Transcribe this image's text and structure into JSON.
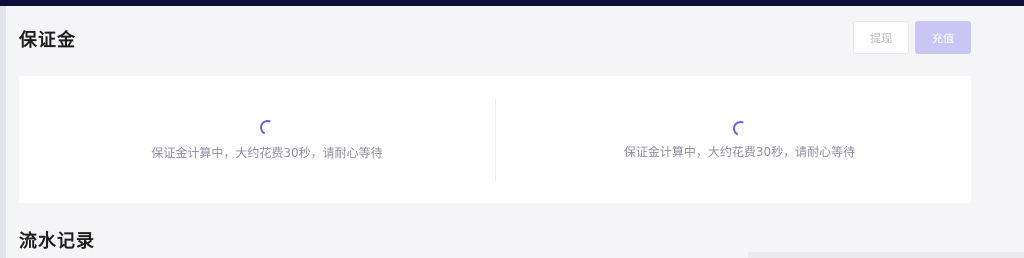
{
  "deposit": {
    "title": "保证金",
    "withdraw_label": "提现",
    "recharge_label": "充值",
    "panels": [
      {
        "loading_text": "保证金计算中，大约花费30秒，请耐心等待"
      },
      {
        "loading_text": "保证金计算中，大约花费30秒，请耐心等待"
      }
    ]
  },
  "flow": {
    "title": "流水记录"
  },
  "colors": {
    "topbar": "#0e0c3a",
    "accent": "#6a63d8",
    "recharge_bg": "#c9c5f5",
    "muted_text": "#8f8fa3"
  },
  "icons": {
    "loading": "loading-spinner-icon"
  }
}
